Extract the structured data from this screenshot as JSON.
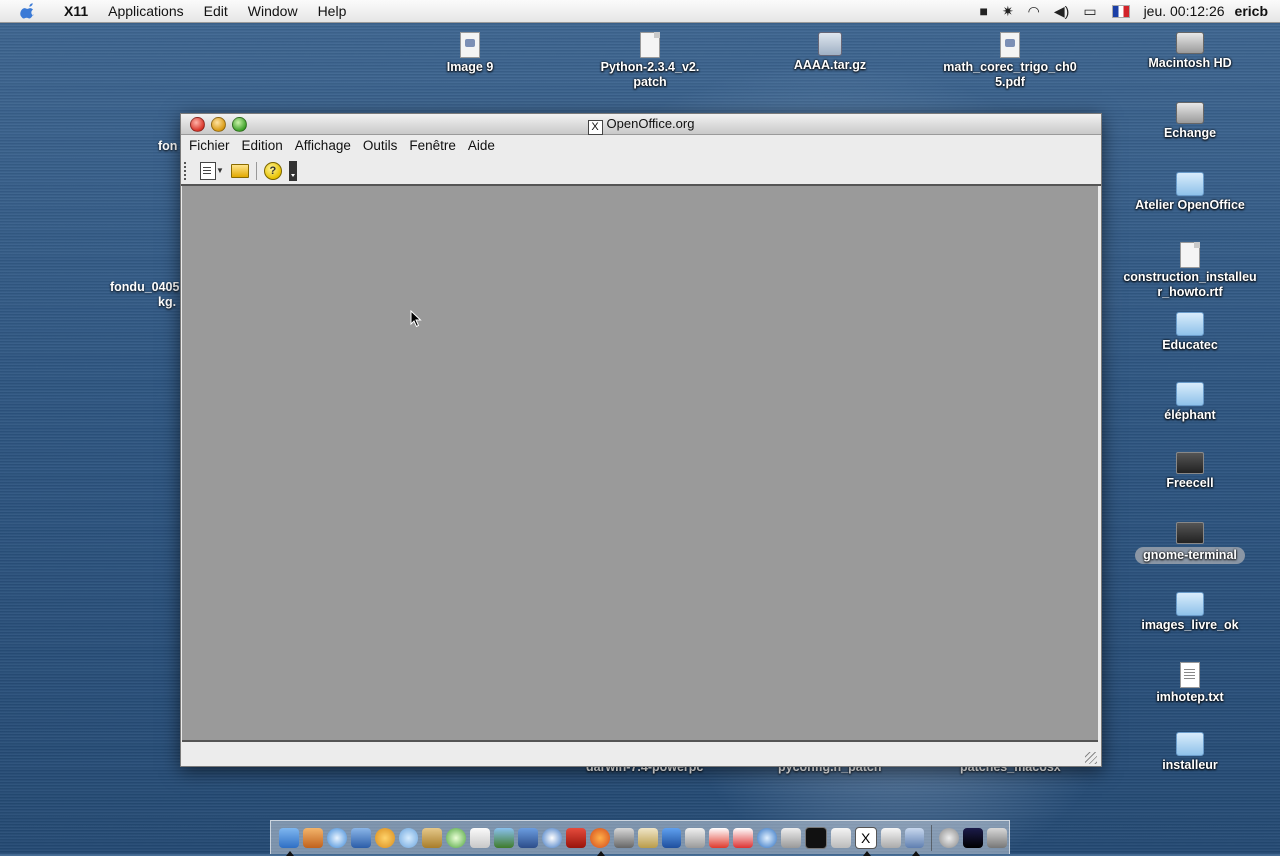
{
  "menubar": {
    "apple_icon": "apple-logo-icon",
    "app_name": "X11",
    "items": [
      "Applications",
      "Edit",
      "Window",
      "Help"
    ],
    "clock": "jeu. 00:12:26",
    "user": "ericb",
    "status_icons": [
      "display-icon",
      "spotlight-activity-icon",
      "wifi-icon",
      "volume-icon",
      "battery-icon",
      "french-flag-icon"
    ]
  },
  "desktop": {
    "icons": [
      {
        "label": "Image 9",
        "kind": "pdf"
      },
      {
        "label": "Python-2.3.4_v2.patch",
        "kind": "file"
      },
      {
        "label": "AAAA.tar.gz",
        "kind": "archive"
      },
      {
        "label": "math_corec_trigo_ch05.pdf",
        "kind": "pdf"
      },
      {
        "label": "Macintosh HD",
        "kind": "disk"
      },
      {
        "label": "Echange",
        "kind": "disk"
      },
      {
        "label": "Atelier OpenOffice",
        "kind": "folder"
      },
      {
        "label": "construction_installeur_howto.rtf",
        "kind": "file"
      },
      {
        "label": "Educatec",
        "kind": "folder"
      },
      {
        "label": "éléphant",
        "kind": "folder"
      },
      {
        "label": "Freecell",
        "kind": "app"
      },
      {
        "label": "gnome-terminal",
        "kind": "app"
      },
      {
        "label": "images_livre_ok",
        "kind": "folder"
      },
      {
        "label": "imhotep.txt",
        "kind": "txt"
      },
      {
        "label": "installeur",
        "kind": "folder"
      }
    ],
    "partial_labels": {
      "left_top": "fon",
      "left_mid": "fondu_0405",
      "left_mid2": "kg.",
      "bottom_1": "darwin-7.4-powerpc",
      "bottom_2": "pyconfig.h_patch",
      "bottom_3": "patches_macosx"
    }
  },
  "window": {
    "title": "OpenOffice.org",
    "title_icon": "x11-icon",
    "menu": [
      {
        "label": "Fichier"
      },
      {
        "label": "Edition"
      },
      {
        "label": "Affichage"
      },
      {
        "label": "Outils"
      },
      {
        "label": "Fenêtre"
      },
      {
        "label": "Aide"
      }
    ],
    "toolbar": [
      "new-document-icon",
      "open-folder-icon",
      "help-icon"
    ]
  },
  "dock": {
    "apps": [
      "finder-icon",
      "mail-stamp-icon",
      "safari-icon",
      "preview-icon",
      "system-prefs-icon",
      "ichat-icon",
      "address-book-icon",
      "itunes-icon",
      "textedit-icon",
      "iphoto-icon",
      "imovie-icon",
      "dvd-icon",
      "acrobat-icon",
      "firefox-icon",
      "mplayer-icon",
      "genie-icon",
      "mathtype-icon",
      "stickies-icon",
      "calculator-icon",
      "ical-icon",
      "quicktime-icon",
      "spotlight-icon",
      "terminal-icon",
      "openoffice-icon",
      "x11-icon",
      "sketch-icon",
      "utility-icon",
      "screenshot-icon",
      "trash-icon"
    ]
  }
}
